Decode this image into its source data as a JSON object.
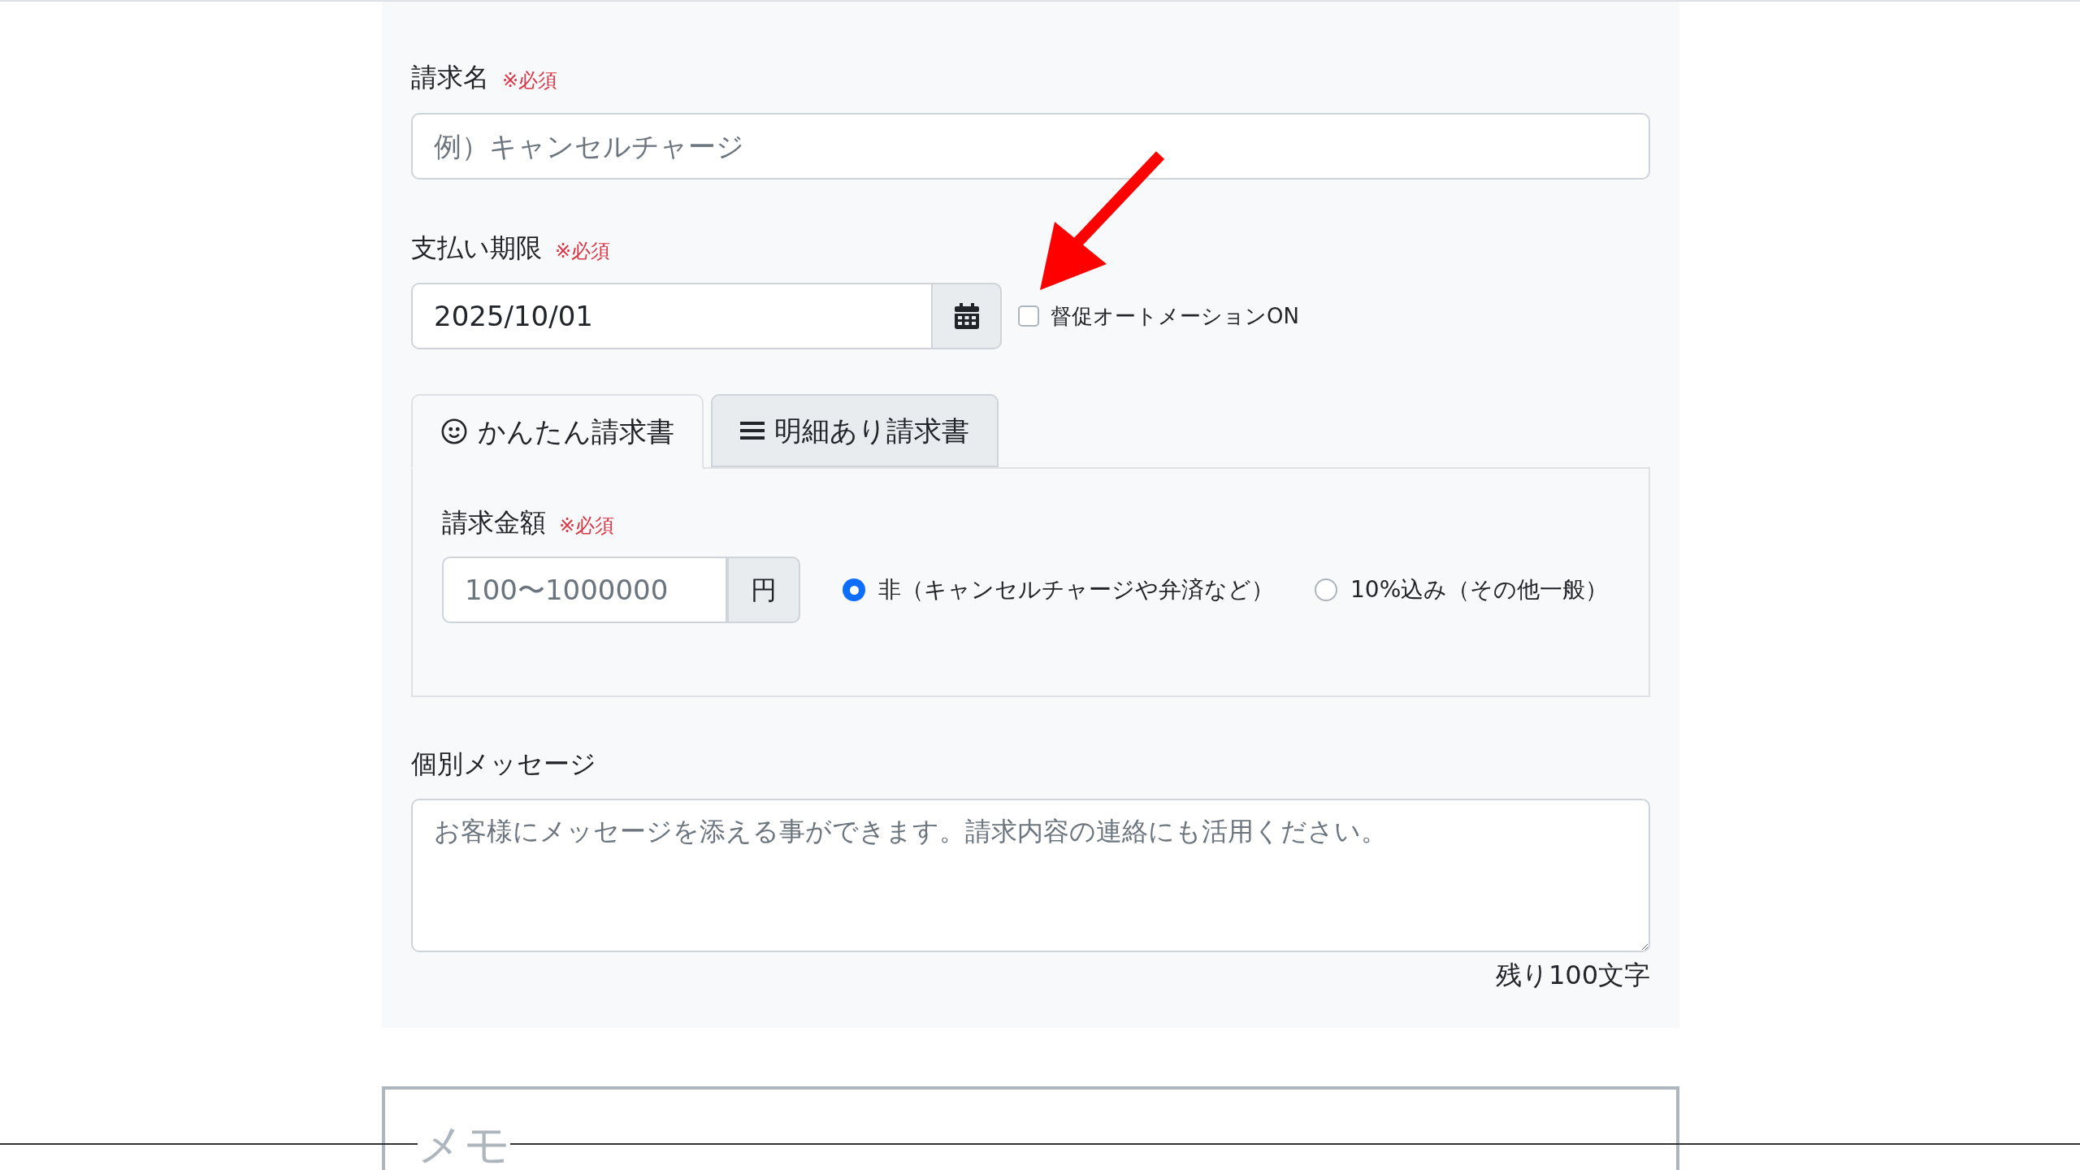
{
  "invoice_name": {
    "label": "請求名",
    "required": "※必須",
    "placeholder": "例）キャンセルチャージ"
  },
  "due_date": {
    "label": "支払い期限",
    "required": "※必須",
    "value": "2025/10/01"
  },
  "auto_reminder": {
    "label": "督促オートメーションON",
    "checked": false
  },
  "tabs": [
    {
      "label": "かんたん請求書",
      "kind": "smile",
      "selected": true
    },
    {
      "label": "明細あり請求書",
      "kind": "list",
      "selected": false
    }
  ],
  "amount": {
    "label": "請求金額",
    "required": "※必須",
    "placeholder": "100〜1000000",
    "unit": "円"
  },
  "tax_options": [
    {
      "label": "非（キャンセルチャージや弁済など）",
      "selected": true
    },
    {
      "label": "10%込み（その他一般）",
      "selected": false
    }
  ],
  "message": {
    "label": "個別メッセージ",
    "placeholder": "お客様にメッセージを添える事ができます。請求内容の連絡にも活用ください。",
    "counter": "残り100文字"
  },
  "memo": {
    "title": "メモ"
  }
}
